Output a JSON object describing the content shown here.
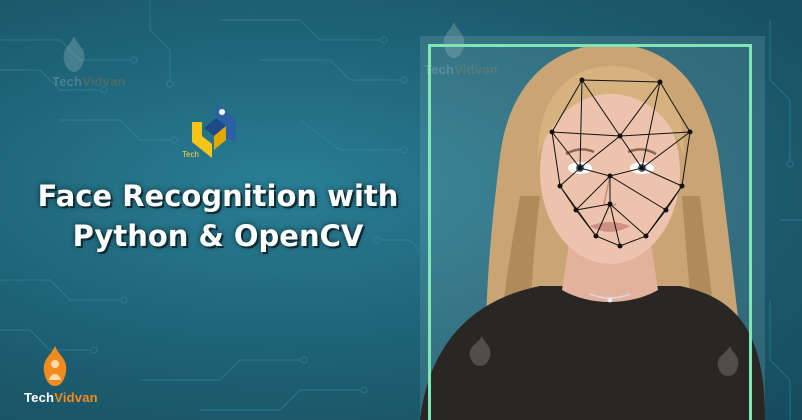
{
  "headline": {
    "line1": "Face Recognition with",
    "line2": "Python & OpenCV"
  },
  "brand": {
    "name_part1": "Tech",
    "name_part2": "Vidvan",
    "logo_icon": "flame-figure-icon",
    "accent_color": "#f28b1e"
  },
  "python_logo": {
    "icon": "python-logo-icon",
    "tag": "Tech"
  },
  "colors": {
    "background": "#1f6478",
    "frame": "#7fe7b3",
    "mesh": "#111111",
    "python_blue": "#2b5fa6",
    "python_yellow": "#f5c518"
  }
}
